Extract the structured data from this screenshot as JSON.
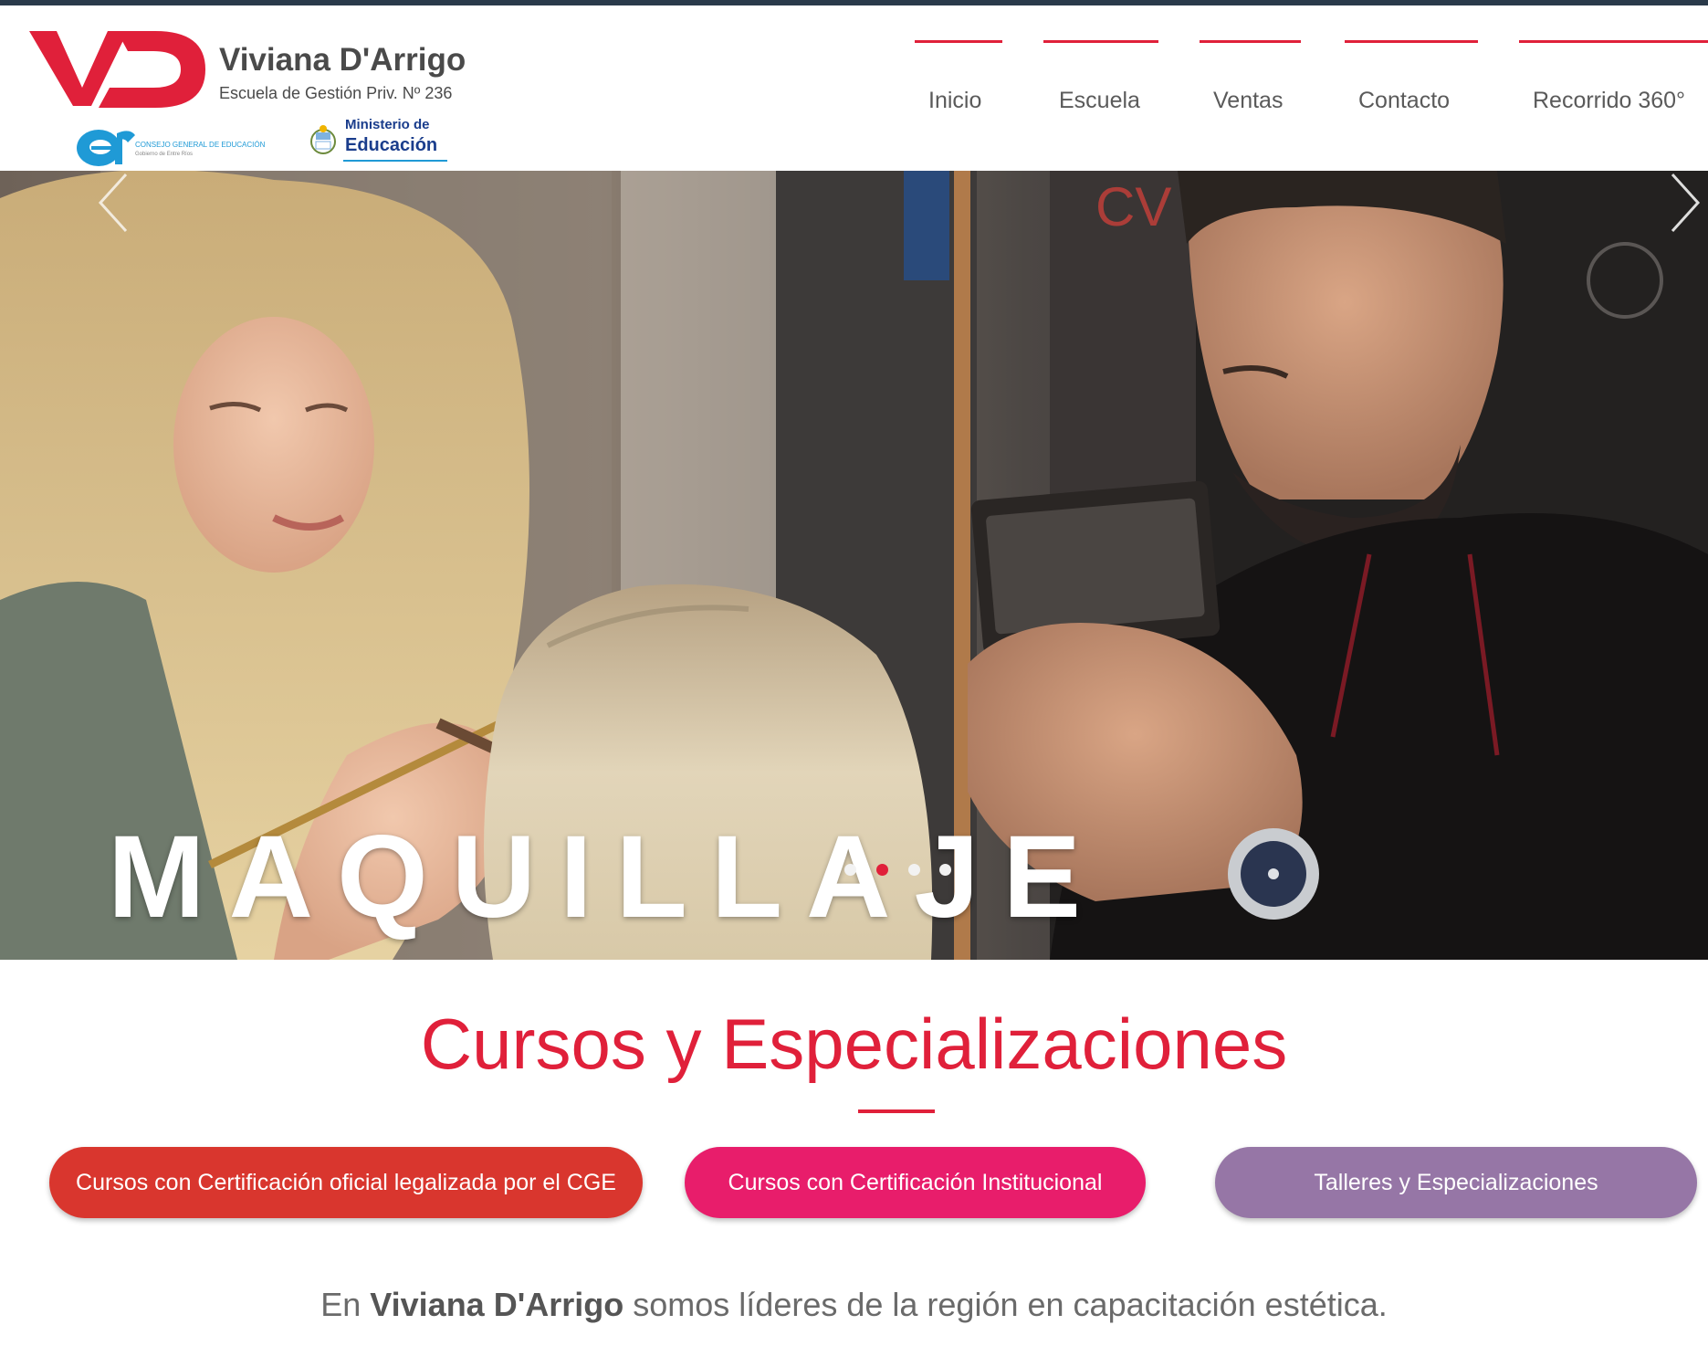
{
  "header": {
    "brand_name": "Viviana D'Arrigo",
    "brand_sub": "Escuela de Gestión Priv. Nº 236",
    "cge_text": "CONSEJO GENERAL DE EDUCACIÓN",
    "cge_sub": "Gobierno de Entre Ríos",
    "ministerio_l1": "Ministerio de",
    "ministerio_l2": "Educación",
    "logo_letters": "VD",
    "cge_letters": "er",
    "accent_color": "#e0203a"
  },
  "nav": {
    "items": [
      {
        "label": "Inicio"
      },
      {
        "label": "Escuela"
      },
      {
        "label": "Ventas"
      },
      {
        "label": "Contacto"
      },
      {
        "label": "Recorrido 360°"
      }
    ]
  },
  "hero": {
    "title": "MAQUILLAJE",
    "prev_icon": "chevron-left-icon",
    "next_icon": "chevron-right-icon",
    "slide_count": 4,
    "active_slide": 2
  },
  "courses": {
    "title": "Cursos y Especializaciones",
    "buttons": [
      {
        "label": "Cursos con Certificación oficial legalizada por el CGE",
        "color": "#d9362e"
      },
      {
        "label": "Cursos con Certificación Institucional",
        "color": "#e81d6b"
      },
      {
        "label": "Talleres y Especializaciones",
        "color": "#9676a6"
      }
    ],
    "intro_prefix": "En ",
    "intro_brand": "Viviana D'Arrigo",
    "intro_rest": " somos líderes de la región en capacitación estética."
  }
}
